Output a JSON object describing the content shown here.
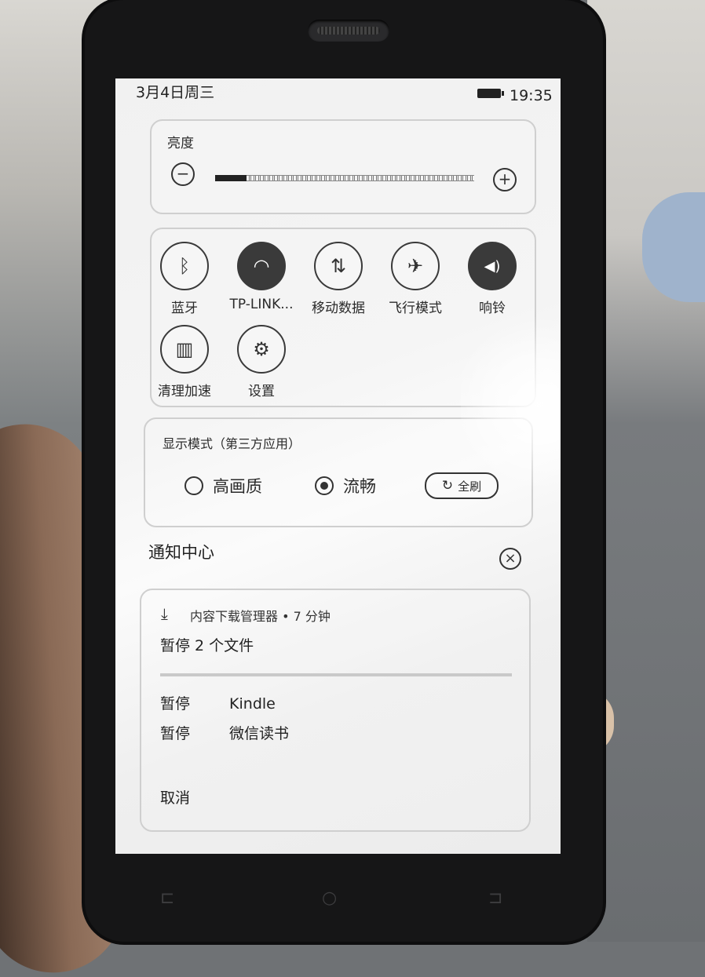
{
  "status_bar": {
    "date": "3月4日周三",
    "time": "19:35"
  },
  "brightness": {
    "label": "亮度",
    "minus_symbol": "−",
    "plus_symbol": "+",
    "level": 0.12
  },
  "quick_toggles": [
    {
      "label": "蓝牙",
      "icon": "bluetooth-icon",
      "glyph": "ᛒ",
      "active": false
    },
    {
      "label": "TP-LINK...",
      "icon": "wifi-icon",
      "glyph": "◠",
      "active": true
    },
    {
      "label": "移动数据",
      "icon": "mobile-data-icon",
      "glyph": "⇅",
      "active": false
    },
    {
      "label": "飞行模式",
      "icon": "airplane-icon",
      "glyph": "✈",
      "active": false
    },
    {
      "label": "响铃",
      "icon": "volume-icon",
      "glyph": "◀)",
      "active": true
    },
    {
      "label": "清理加速",
      "icon": "broom-icon",
      "glyph": "▥",
      "active": false
    },
    {
      "label": "设置",
      "icon": "gear-icon",
      "glyph": "⚙",
      "active": false
    }
  ],
  "display_mode": {
    "label": "显示模式（第三方应用）",
    "options": [
      {
        "label": "高画质",
        "selected": false
      },
      {
        "label": "流畅",
        "selected": true
      }
    ],
    "refresh_label": "全刷",
    "refresh_glyph": "↻"
  },
  "notification_center": {
    "title": "通知中心",
    "clear_symbol": "×",
    "notification": {
      "source": "内容下载管理器 • 7 分钟",
      "download_glyph": "⤓",
      "heading": "暂停 2 个文件",
      "progress": 0.0,
      "items": [
        {
          "state": "暂停",
          "name": "Kindle"
        },
        {
          "state": "暂停",
          "name": "微信读书"
        }
      ],
      "cancel_label": "取消"
    }
  },
  "hardware_nav": {
    "back": "⊏",
    "home": "○",
    "recent": "⊐"
  },
  "colors": {
    "screen_bg": "#f2f2f2",
    "ink": "#2a2a2a",
    "active_tile": "#3a3a3a",
    "phone_body": "#161617"
  }
}
